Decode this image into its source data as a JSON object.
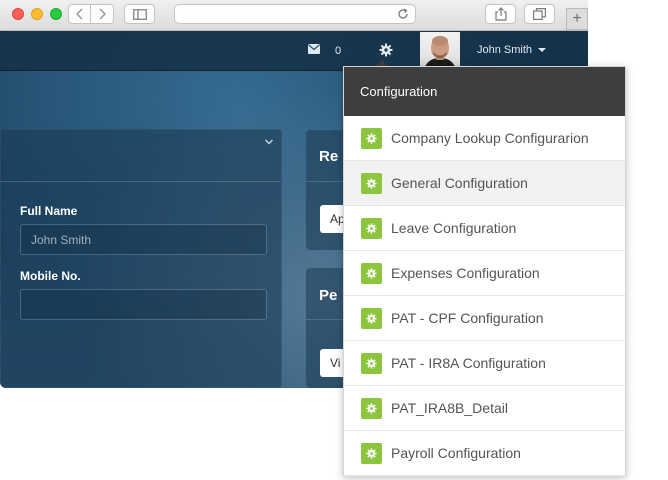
{
  "browser": {
    "new_tab_label": "+"
  },
  "topbar": {
    "mail_count": "0",
    "user_name": "John Smith"
  },
  "form": {
    "full_name_label": "Full Name",
    "full_name_value": "John Smith",
    "mobile_label": "Mobile No.",
    "mobile_value": ""
  },
  "side_panels": {
    "panel1_title": "Re",
    "panel1_button": "Ap",
    "panel2_title": "Pe",
    "panel2_button": "Vi"
  },
  "configuration_menu": {
    "title": "Configuration",
    "items": [
      {
        "label": "Company Lookup Configurarion"
      },
      {
        "label": "General Configuration"
      },
      {
        "label": "Leave Configuration"
      },
      {
        "label": "Expenses Configuration"
      },
      {
        "label": "PAT - CPF Configuration"
      },
      {
        "label": "PAT - IR8A Configuration"
      },
      {
        "label": "PAT_IRA8B_Detail"
      },
      {
        "label": "Payroll Configuration"
      }
    ],
    "active_index": 1
  },
  "colors": {
    "accent_green": "#8cc63f",
    "menu_header": "#3e3e3e",
    "app_background": "#1f4a6a"
  },
  "icons": {
    "menu_item_icon": "gear-icon",
    "topbar_mail": "envelope-icon",
    "topbar_settings": "gear-icon"
  }
}
